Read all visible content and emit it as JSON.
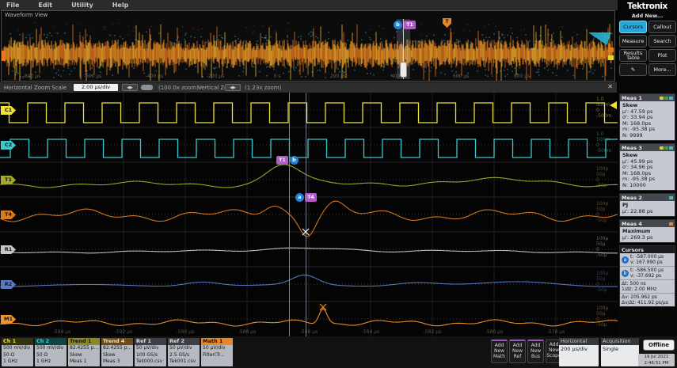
{
  "menu": {
    "items": [
      "File",
      "Edit",
      "Utility",
      "Help"
    ]
  },
  "overview": {
    "title": "Waveform View",
    "ticks": [
      "-800 µs",
      "-600 µs",
      "-400 µs",
      "-200 µs",
      "0 s",
      "200 µs",
      "400 µs",
      "600 µs",
      "800 µs"
    ],
    "trigger_label": "T",
    "cursor_b": "b",
    "cursor_box": "T1"
  },
  "zoom_toolbar": {
    "h_label": "Horizontal Zoom Scale",
    "h_value": "2.00 µs/div",
    "stepper_arrows": "◀▶",
    "h_zoom": "(100.0x zoom)",
    "v_label": "Vertical Zoom",
    "v_zoom": "(1.23x zoom)",
    "close": "✕"
  },
  "main_view": {
    "ticks": [
      "-594 µs",
      "-592 µs",
      "-590 µs",
      "-588 µs",
      "-586 µs",
      "-584 µs",
      "-582 µs",
      "-580 µs",
      "-578 µs"
    ]
  },
  "waveform_flags": {
    "source_b": "T1",
    "b": "b",
    "a": "a",
    "source_a": "T4"
  },
  "waveforms": {
    "rows": [
      {
        "label": "C1",
        "color": "#ece23a",
        "type": "square1",
        "ladder": [
          "1.0",
          "500m",
          "0",
          "-500m"
        ]
      },
      {
        "label": "C2",
        "color": "#3cc8cc",
        "type": "square2",
        "ladder": [
          "1.0",
          "500m",
          "0",
          "-500m"
        ]
      },
      {
        "label": "T1",
        "color": "#a6aa2a",
        "type": "trend1",
        "ladder": [
          "100p",
          "50p",
          "0",
          "-50p"
        ]
      },
      {
        "label": "T4",
        "color": "#d87c1e",
        "type": "trend2",
        "ladder": [
          "100p",
          "50p",
          "0",
          "-50p"
        ]
      },
      {
        "label": "R1",
        "color": "#c4c6ca",
        "type": "trend3",
        "ladder": [
          "100µ",
          "50µ",
          "0",
          "-50µ"
        ]
      },
      {
        "label": "R2",
        "color": "#5a7ac8",
        "type": "trend4",
        "ladder": [
          "100µ",
          "50µ",
          "0",
          "-50µ"
        ]
      },
      {
        "label": "M1",
        "color": "#f0952c",
        "type": "trend5",
        "ladder": [
          "100µ",
          "50µ",
          "0",
          "-50µ"
        ]
      }
    ]
  },
  "sidebar": {
    "brand": "Tektronix",
    "add_new": "Add New...",
    "buttons": [
      {
        "label": "Cursors",
        "active": true
      },
      {
        "label": "Callout"
      },
      {
        "label": "Measure"
      },
      {
        "label": "Search"
      },
      {
        "label": "Results Table"
      },
      {
        "label": "Plot"
      },
      {
        "label": "✎",
        "icon": true
      },
      {
        "label": "More..."
      }
    ],
    "meas_panels": [
      {
        "id": "meas1",
        "title": "Meas 1",
        "chips": [
          "#d8d020",
          "#38a838",
          "#38c0c8"
        ],
        "name": "Skew",
        "stats": [
          "µ': 47.59 ps",
          "σ': 33.94 ps",
          "M: 168.0ps",
          "m: -95.38 ps",
          "N: 9999"
        ]
      },
      {
        "id": "meas3",
        "title": "Meas 3",
        "chips": [
          "#d8d020",
          "#38a838",
          "#38c0c8"
        ],
        "name": "Skew",
        "stats": [
          "µ': 45.99 ps",
          "σ': 34.96 ps",
          "M: 168.0ps",
          "m: -95.38 ps",
          "N: 10000"
        ]
      },
      {
        "id": "meas2",
        "title": "Meas 2",
        "chips": [
          "#38c0c8"
        ],
        "name": "PJ",
        "stats": [
          "µ': 22.88 ps"
        ]
      },
      {
        "id": "meas4",
        "title": "Meas 4",
        "chips": [
          "#e88828"
        ],
        "name": "Maximum",
        "stats": [
          "µ': 269.3 ps"
        ]
      }
    ],
    "cursors": {
      "title": "Cursors",
      "rows": [
        {
          "marker": "a",
          "lines": [
            "t: -587.000 µs",
            "v: 167.990 ps"
          ]
        },
        {
          "marker": "b",
          "lines": [
            "t: -586.500 µs",
            "v: -37.692 ps"
          ]
        },
        {
          "lines": [
            "Δt: 500 ns",
            "1/Δt: 2.00 MHz"
          ]
        },
        {
          "lines": [
            "Δv: 205.962 ps",
            "Δv/Δt: 411.92 ps/µs"
          ]
        }
      ]
    }
  },
  "bottom": {
    "badges": [
      {
        "title": "Ch 1",
        "hbg": "#33330e",
        "hfg": "#e8e030",
        "lines": [
          "500 mV/div",
          "50 Ω",
          "1 GHz"
        ]
      },
      {
        "title": "Ch 2",
        "hbg": "#0e4444",
        "hfg": "#40d0d0",
        "lines": [
          "500 mV/div",
          "50 Ω",
          "1 GHz"
        ]
      },
      {
        "title": "Trend 1",
        "hbg": "#8a8a20",
        "hfg": "#14140a",
        "lines": [
          "82.4255 p...",
          "Skew",
          "Meas 1"
        ]
      },
      {
        "title": "Trend 4",
        "hbg": "#6e4a16",
        "hfg": "#f0e0c0",
        "lines": [
          "82.4255 p...",
          "Skew",
          "Meas 3"
        ]
      },
      {
        "title": "Ref 1",
        "hbg": "#3c4046",
        "hfg": "#d8dce0",
        "lines": [
          "50 µV/div",
          "100 GS/s",
          "Tek000.csv"
        ]
      },
      {
        "title": "Ref 2",
        "hbg": "#3c4046",
        "hfg": "#d8dce0",
        "lines": [
          "50 µV/div",
          "2.5 GS/s",
          "Tek001.csv"
        ]
      },
      {
        "title": "Math 1",
        "hbg": "#e8872a",
        "hfg": "#1a1206",
        "lines": [
          "50 µV/div",
          "Filter(Tr..."
        ]
      }
    ],
    "add_buttons": [
      {
        "lines": [
          "Add",
          "New",
          "Math"
        ],
        "accent": true
      },
      {
        "lines": [
          "Add",
          "New",
          "Ref"
        ],
        "accent": true
      },
      {
        "lines": [
          "Add",
          "New",
          "Bus"
        ],
        "accent": true
      },
      {
        "lines": [
          "Add",
          "New",
          "Scope"
        ],
        "accent": false
      }
    ],
    "horizontal": {
      "title": "Horizontal",
      "value": "200 µs/div"
    },
    "acquisition": {
      "title": "Acquisition",
      "value": "Single"
    },
    "offline_label": "Offline",
    "datetime": {
      "date": "19 Jul 2021",
      "time": "2:46:51 PM"
    }
  }
}
